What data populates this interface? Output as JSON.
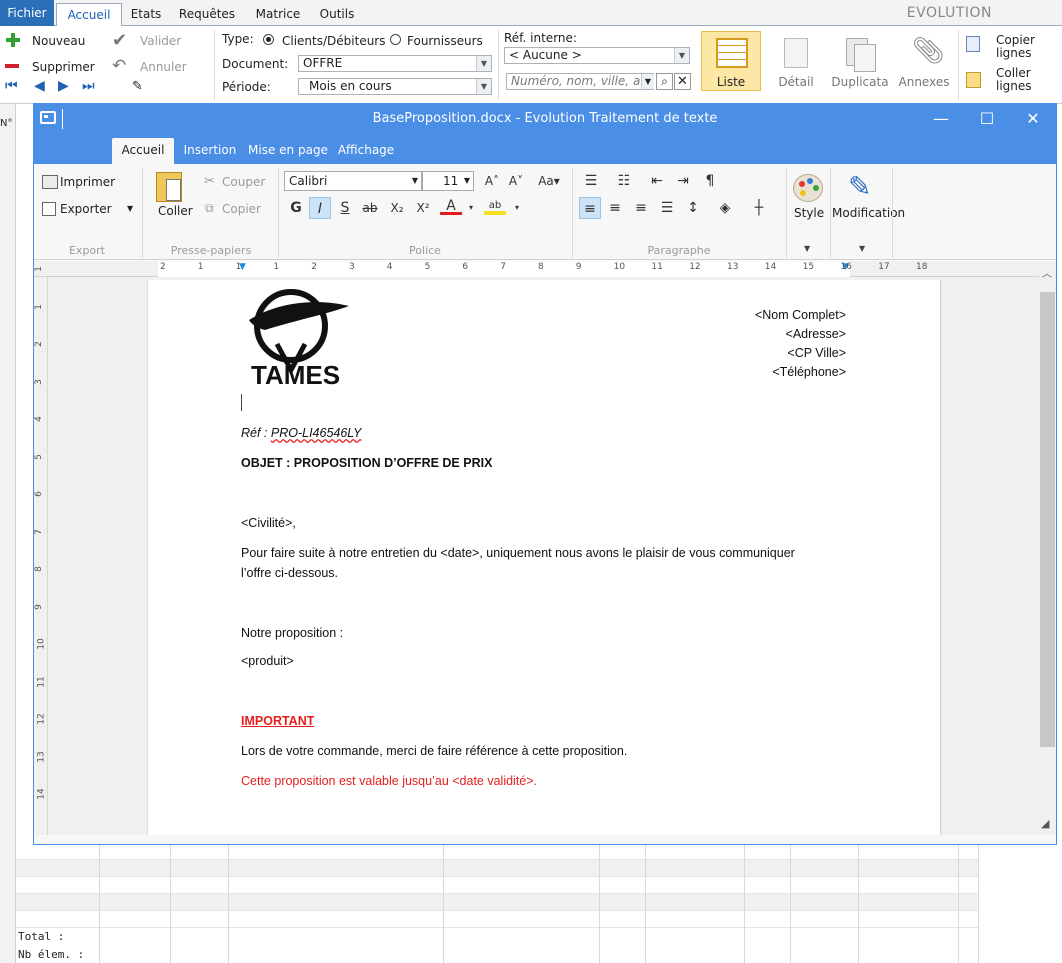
{
  "background_app": {
    "file_tab": "Fichier",
    "tabs": [
      "Accueil",
      "Etats",
      "Requêtes",
      "Matrice",
      "Outils"
    ],
    "brand": "EVOLUTION",
    "commands": {
      "nouveau": "Nouveau",
      "supprimer": "Supprimer",
      "valider": "Valider",
      "annuler": "Annuler"
    },
    "filters": {
      "type_label": "Type:",
      "type_opt1": "Clients/Débiteurs",
      "type_opt2": "Fournisseurs",
      "document_label": "Document:",
      "document_value": "OFFRE",
      "periode_label": "Période:",
      "periode_value": "Mois en cours",
      "ref_label": "Réf. interne:",
      "ref_value": "< Aucune >",
      "search_placeholder": "Numéro, nom, ville, ab"
    },
    "big_buttons": {
      "liste": "Liste",
      "detail": "Détail",
      "duplicata": "Duplicata",
      "annexes": "Annexes",
      "copier": "Copier lignes",
      "coller": "Coller lignes"
    },
    "left_marker": "N°",
    "footer": {
      "total": "Total :",
      "nb_elem": "Nb élem. :"
    }
  },
  "editor": {
    "title": "BaseProposition.docx - Evolution Traitement de texte",
    "tabs": [
      "Accueil",
      "Insertion",
      "Mise en page",
      "Affichage"
    ],
    "ribbon": {
      "imprimer": "Imprimer",
      "exporter": "Exporter",
      "export_group": "Export",
      "coller": "Coller",
      "couper": "Couper",
      "copier": "Copier",
      "clipboard_group": "Presse-papiers",
      "font_name": "Calibri",
      "font_size": "11",
      "police_group": "Police",
      "paragraphe_group": "Paragraphe",
      "style": "Style",
      "modification": "Modification"
    },
    "ruler_numbers": [
      "2",
      "1",
      "1",
      "1",
      "2",
      "3",
      "4",
      "5",
      "6",
      "7",
      "8",
      "9",
      "10",
      "11",
      "12",
      "13",
      "14",
      "15",
      "16",
      "17",
      "18"
    ],
    "vruler_numbers": [
      "1",
      "1",
      "2",
      "3",
      "4",
      "5",
      "6",
      "7",
      "8",
      "9",
      "10",
      "11",
      "12",
      "13",
      "14"
    ],
    "document": {
      "logo_text": "TAMES",
      "address": [
        "<Nom Complet>",
        "<Adresse>",
        "<CP Ville>",
        "<Téléphone>"
      ],
      "ref_prefix": "Réf : ",
      "ref_value": "PRO-LI46546LY",
      "objet": "OBJET : PROPOSITION D’OFFRE DE PRIX",
      "civilite": "<Civilité>,",
      "para1_line1": "Pour faire suite à notre entretien du <date>, uniquement nous avons le plaisir de vous communiquer",
      "para1_line2": "l’offre ci-dessous.",
      "proposition": "Notre proposition :",
      "produit": "<produit>",
      "important": "IMPORTANT",
      "commande": "Lors de votre commande, merci de faire référence à cette proposition.",
      "validite": "Cette proposition est valable jusqu’au <date validité>."
    }
  },
  "colors": {
    "titlebar": "#4a8ee6",
    "accent_red": "#e41e1e",
    "liste_highlight": "#fde7a5"
  }
}
